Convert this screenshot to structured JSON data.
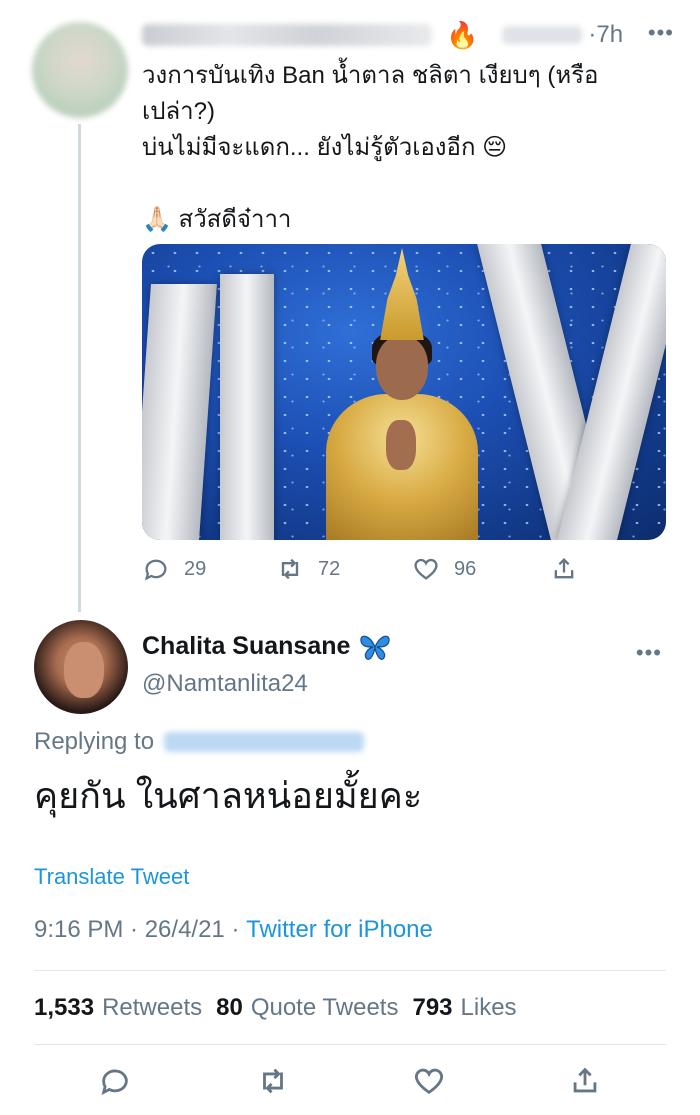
{
  "parent_tweet": {
    "time_separator": "·",
    "time": "7h",
    "fire_emoji": "🔥",
    "more_label": "•••",
    "text_lines": [
      "วงการบันเทิง Ban น้ำตาล ชลิตา เงียบๆ (หรือ",
      "เปล่า?)",
      "บ่นไม่มีจะแดก... ยังไม่รู้ตัวเองอีก 😔",
      "",
      "🙏🏻 สวัสดีจ๋าาา"
    ],
    "actions": {
      "reply_count": "29",
      "retweet_count": "72",
      "like_count": "96"
    }
  },
  "main_tweet": {
    "display_name": "Chalita Suansane",
    "handle": "@Namtanlita24",
    "more_label": "•••",
    "replying_to_label": "Replying to",
    "text": "คุยกัน ในศาลหน่อยมั้ยคะ",
    "translate_label": "Translate Tweet",
    "timestamp": "9:16 PM · 26/4/21 · ",
    "source": "Twitter for iPhone",
    "stats": {
      "retweets_count": "1,533",
      "retweets_label": "Retweets",
      "quotes_count": "80",
      "quotes_label": "Quote Tweets",
      "likes_count": "793",
      "likes_label": "Likes"
    }
  },
  "colors": {
    "link": "#1b95e0",
    "secondary_text": "#657786",
    "primary_text": "#14171a",
    "divider": "#e1e8ed",
    "butterfly": "#2f8ce0"
  }
}
